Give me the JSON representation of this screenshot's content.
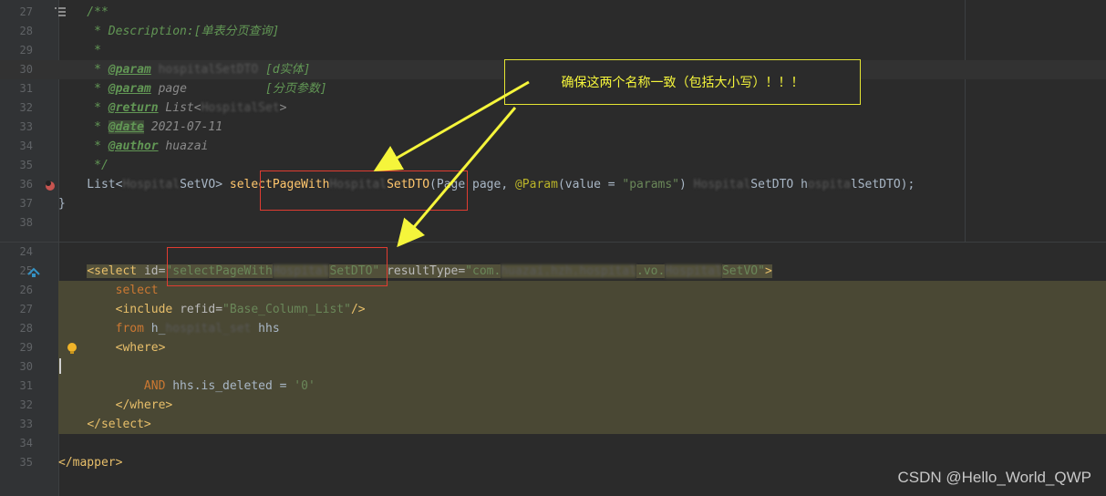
{
  "top_editor": {
    "lines": [
      {
        "n": "27",
        "segs": [
          {
            "c": "c-doc",
            "t": "    /**"
          }
        ]
      },
      {
        "n": "28",
        "segs": [
          {
            "c": "c-doc",
            "t": "     * Description:[单表分页查询]"
          }
        ]
      },
      {
        "n": "29",
        "segs": [
          {
            "c": "c-doc",
            "t": "     *"
          }
        ]
      },
      {
        "n": "30",
        "segs": [
          {
            "c": "c-doc",
            "t": "     * "
          },
          {
            "c": "c-tag",
            "t": "@param"
          },
          {
            "c": "c-blur",
            "t": " hospitalSetDTO"
          },
          {
            "c": "c-doc",
            "t": " [d实体]"
          }
        ]
      },
      {
        "n": "31",
        "segs": [
          {
            "c": "c-doc",
            "t": "     * "
          },
          {
            "c": "c-tag",
            "t": "@param"
          },
          {
            "c": "c-ref",
            "t": " page"
          },
          {
            "c": "c-doc",
            "t": "           [分页参数]"
          }
        ]
      },
      {
        "n": "32",
        "segs": [
          {
            "c": "c-doc",
            "t": "     * "
          },
          {
            "c": "c-tag",
            "t": "@return"
          },
          {
            "c": "c-ref",
            "t": " List<"
          },
          {
            "c": "c-blur",
            "t": "HospitalSet"
          },
          {
            "c": "c-ref",
            "t": ">"
          }
        ]
      },
      {
        "n": "33",
        "segs": [
          {
            "c": "c-doc",
            "t": "     * "
          },
          {
            "c": "c-tag c-tagbg",
            "t": "@date"
          },
          {
            "c": "c-ref",
            "t": " 2021-07-11"
          }
        ]
      },
      {
        "n": "34",
        "segs": [
          {
            "c": "c-doc",
            "t": "     * "
          },
          {
            "c": "c-tag",
            "t": "@author"
          },
          {
            "c": "c-ref",
            "t": " huazai"
          }
        ]
      },
      {
        "n": "35",
        "segs": [
          {
            "c": "c-doc",
            "t": "     */"
          }
        ]
      },
      {
        "n": "36",
        "segs": [
          {
            "c": "c-txt",
            "t": "    List<"
          },
          {
            "c": "c-blur",
            "t": "Hospital"
          },
          {
            "c": "c-txt",
            "t": "SetVO> "
          },
          {
            "c": "c-fn",
            "t": "selectPageWith"
          },
          {
            "c": "c-blur",
            "t": "Hospital"
          },
          {
            "c": "c-fn",
            "t": "SetDTO"
          },
          {
            "c": "c-txt",
            "t": "(Page page, "
          },
          {
            "c": "c-ann",
            "t": "@Param"
          },
          {
            "c": "c-txt",
            "t": "(value = "
          },
          {
            "c": "c-str",
            "t": "\"params\""
          },
          {
            "c": "c-txt",
            "t": ") "
          },
          {
            "c": "c-blur",
            "t": "Hospital"
          },
          {
            "c": "c-txt",
            "t": "SetDTO h"
          },
          {
            "c": "c-blur",
            "t": "ospita"
          },
          {
            "c": "c-txt",
            "t": "lSetDTO);"
          }
        ]
      },
      {
        "n": "37",
        "segs": [
          {
            "c": "c-txt",
            "t": "}"
          }
        ]
      },
      {
        "n": "38",
        "segs": []
      }
    ]
  },
  "bottom_editor": {
    "lines": [
      {
        "n": "24",
        "segs": []
      },
      {
        "n": "25",
        "segs": [
          {
            "c": "c-txt",
            "t": "    "
          },
          {
            "c": "c-tagxml xmlbg",
            "t": "<select "
          },
          {
            "c": "c-attr xmlbg",
            "t": "id="
          },
          {
            "c": "c-val xmlbg",
            "t": "\"selectPageWith"
          },
          {
            "c": "c-blur xmlbg",
            "t": "Hospital"
          },
          {
            "c": "c-val xmlbg",
            "t": "SetDTO\" "
          },
          {
            "c": "c-attr xmlbg",
            "t": "resultType="
          },
          {
            "c": "c-val xmlbg",
            "t": "\"com."
          },
          {
            "c": "c-blur xmlbg",
            "t": "huazai.hzh.hospital"
          },
          {
            "c": "c-val xmlbg",
            "t": ".vo."
          },
          {
            "c": "c-blur xmlbg",
            "t": "Hospital"
          },
          {
            "c": "c-val xmlbg",
            "t": "SetVO\""
          },
          {
            "c": "c-tagxml xmlbg",
            "t": ">"
          }
        ]
      },
      {
        "n": "26",
        "segs": [
          {
            "c": "c-txt",
            "t": "        "
          },
          {
            "c": "c-sql",
            "t": "select"
          }
        ]
      },
      {
        "n": "27",
        "segs": [
          {
            "c": "c-txt",
            "t": "        "
          },
          {
            "c": "c-tagxml",
            "t": "<include "
          },
          {
            "c": "c-attr",
            "t": "refid="
          },
          {
            "c": "c-val",
            "t": "\"Base_Column_List\""
          },
          {
            "c": "c-tagxml",
            "t": "/>"
          }
        ]
      },
      {
        "n": "28",
        "segs": [
          {
            "c": "c-txt",
            "t": "        "
          },
          {
            "c": "c-sql",
            "t": "from "
          },
          {
            "c": "c-txt",
            "t": "h_"
          },
          {
            "c": "c-blur",
            "t": "hospital_set"
          },
          {
            "c": "c-txt",
            "t": " hhs"
          }
        ]
      },
      {
        "n": "29",
        "segs": [
          {
            "c": "c-txt",
            "t": "        "
          },
          {
            "c": "c-tagxml",
            "t": "<where>"
          }
        ]
      },
      {
        "n": "30",
        "segs": []
      },
      {
        "n": "31",
        "segs": [
          {
            "c": "c-txt",
            "t": "            "
          },
          {
            "c": "c-sql",
            "t": "AND "
          },
          {
            "c": "c-txt",
            "t": "hhs.is_deleted = "
          },
          {
            "c": "c-val",
            "t": "'0'"
          }
        ]
      },
      {
        "n": "32",
        "segs": [
          {
            "c": "c-txt",
            "t": "        "
          },
          {
            "c": "c-tagxml",
            "t": "</where>"
          }
        ]
      },
      {
        "n": "33",
        "segs": [
          {
            "c": "c-txt",
            "t": "    "
          },
          {
            "c": "c-tagxml",
            "t": "</select>"
          }
        ]
      },
      {
        "n": "34",
        "segs": []
      },
      {
        "n": "35",
        "segs": [
          {
            "c": "c-tagxml",
            "t": "</mapper>"
          }
        ]
      }
    ]
  },
  "callout": {
    "text": "确保这两个名称一致（包括大小写）！！！"
  },
  "watermark": {
    "text": "CSDN @Hello_World_QWP"
  },
  "colors": {
    "arrow": "#f5f53b",
    "box": "#e03c31"
  },
  "icons": {
    "bookmark": "bookmark-icon",
    "debug": "debug-breakpoint-icon",
    "xml_link": "mapper-link-icon",
    "bulb": "lightbulb-icon"
  }
}
